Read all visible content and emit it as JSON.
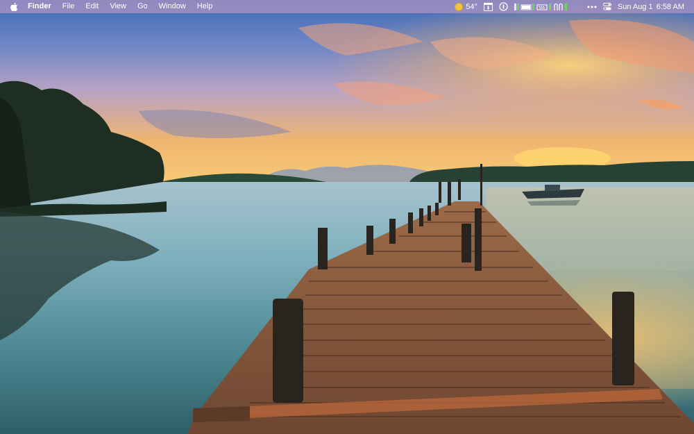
{
  "menubar": {
    "apple_menu": "Apple",
    "app_name": "Finder",
    "items": [
      "File",
      "Edit",
      "View",
      "Go",
      "Window",
      "Help"
    ],
    "status": {
      "weather_temp": "54°",
      "date": "Sun Aug 1",
      "time": "6:58 AM"
    },
    "icons": [
      "weather-sun-icon",
      "calendar-icon",
      "focus-icon",
      "system-monitor-icon",
      "battery-icon",
      "keyboard-icon",
      "network-monitor-icon",
      "more-icon",
      "control-center-icon"
    ]
  },
  "wallpaper": {
    "description_colors": {
      "sky_top": "#4a6fb0",
      "sky_glow": "#f7c67a",
      "water": "#5a97a4",
      "dock_wood": "#8a5a3c"
    }
  }
}
